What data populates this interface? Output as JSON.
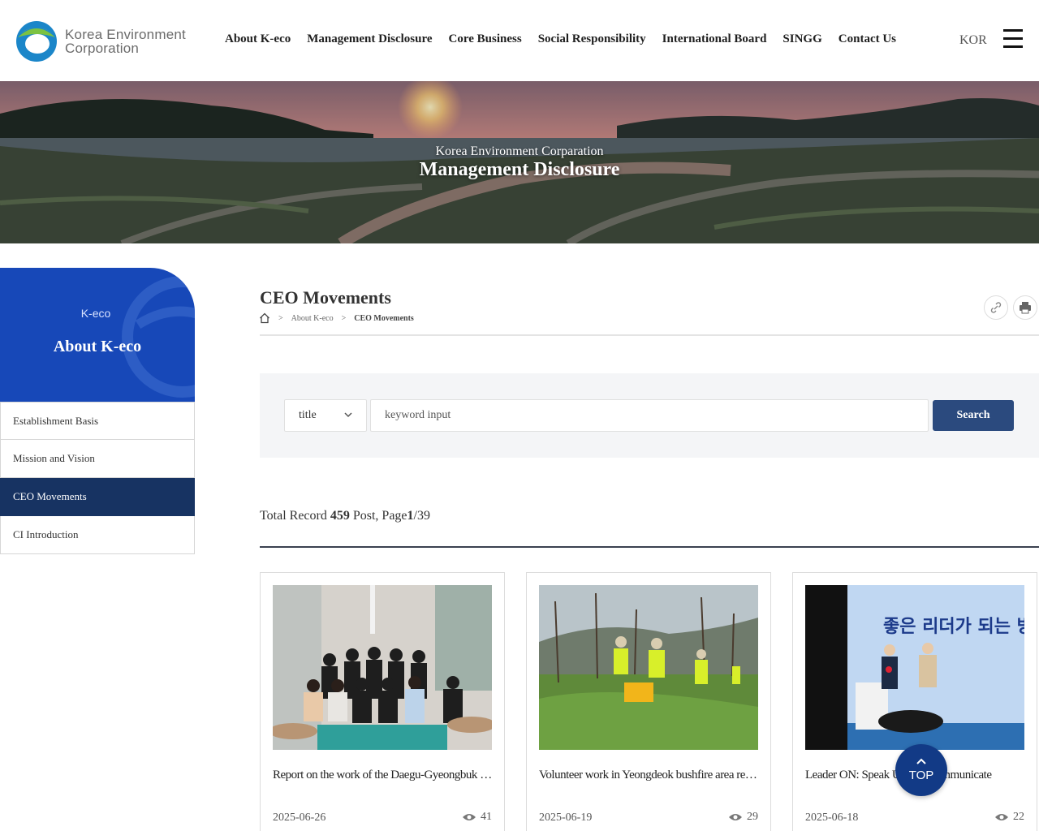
{
  "header": {
    "logo": {
      "line1": "Korea Environment",
      "line2": "Corporation"
    },
    "nav": [
      "About K-eco",
      "Management Disclosure",
      "Core Business",
      "Social Responsibility",
      "International Board",
      "SINGG",
      "Contact Us"
    ],
    "lang": "KOR",
    "menu_icon": "hamburger-icon"
  },
  "banner": {
    "subtitle": "Korea Environment Corparation",
    "title": "Management Disclosure"
  },
  "sidebar": {
    "sub": "K-eco",
    "title": "About K-eco",
    "items": [
      "Establishment Basis",
      "Mission and Vision",
      "CEO Movements",
      "CI Introduction"
    ],
    "active_index": 2
  },
  "content": {
    "title": "CEO Movements",
    "breadcrumb": {
      "home_icon": "home-icon",
      "sep": ">",
      "level1": "About K-eco",
      "level2": "CEO Movements"
    },
    "util_icons": [
      "link-icon",
      "print-icon"
    ],
    "search": {
      "select_value": "title",
      "placeholder": "keyword input",
      "button": "Search"
    },
    "total": {
      "prefix": "Total Record",
      "count": "459",
      "post": "Post, Page",
      "page": "1",
      "pages": "/39"
    },
    "cards": [
      {
        "title": "Report on the work of the Daegu-Gyeongbuk regional headquarters",
        "date": "2025-06-26",
        "views": "41"
      },
      {
        "title": "Volunteer work in Yeongdeok bushfire area restoration",
        "date": "2025-06-19",
        "views": "29"
      },
      {
        "title": "Leader ON: Speak Up and Communicate",
        "date": "2025-06-18",
        "views": "22"
      }
    ],
    "card3_sign": "좋은 리더가 되는 방법"
  },
  "top_button": "TOP",
  "colors": {
    "primary_blue": "#1748b8",
    "navy": "#173362",
    "button": "#2b4a7e"
  }
}
